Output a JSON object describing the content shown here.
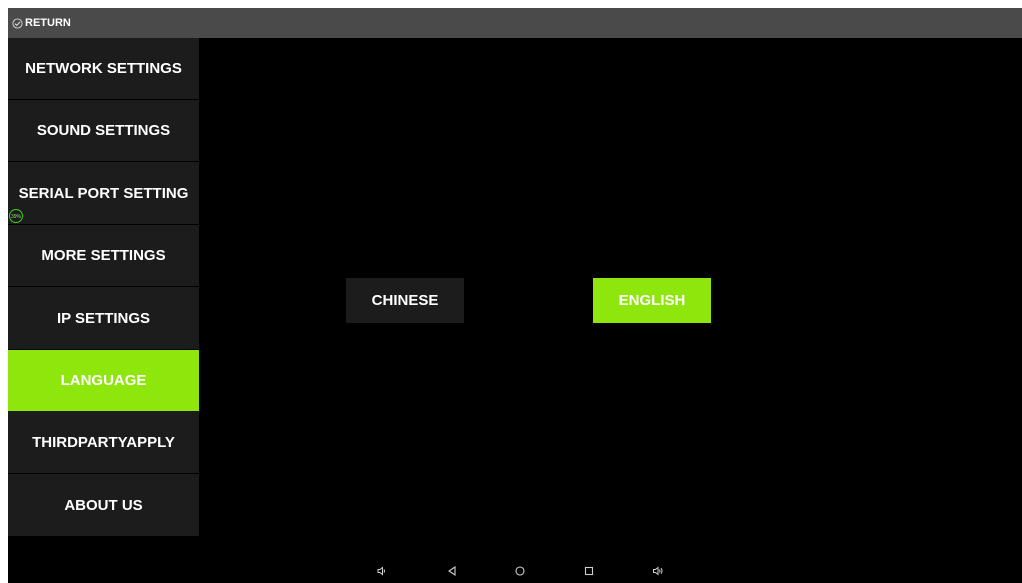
{
  "topbar": {
    "return_label": "RETURN"
  },
  "sidebar": {
    "items": [
      {
        "label": "NETWORK SETTINGS",
        "active": false
      },
      {
        "label": "SOUND SETTINGS",
        "active": false
      },
      {
        "label": "SERIAL PORT SETTING",
        "active": false
      },
      {
        "label": "MORE SETTINGS",
        "active": false
      },
      {
        "label": "IP SETTINGS",
        "active": false
      },
      {
        "label": "LANGUAGE",
        "active": true
      },
      {
        "label": "THIRDPARTYAPPLY",
        "active": false
      },
      {
        "label": "ABOUT US",
        "active": false
      }
    ],
    "overlay_badge": "39%"
  },
  "language": {
    "options": [
      {
        "label": "CHINESE",
        "selected": false
      },
      {
        "label": "ENGLISH",
        "selected": true
      }
    ]
  },
  "navbar": {
    "icons": [
      "volume-down-icon",
      "back-icon",
      "home-icon",
      "recents-icon",
      "volume-up-icon"
    ]
  },
  "colors": {
    "accent": "#8fe60c",
    "sidebar_bg": "#1c1c1c",
    "topbar_bg": "#4a4a4a",
    "background": "#000000"
  }
}
